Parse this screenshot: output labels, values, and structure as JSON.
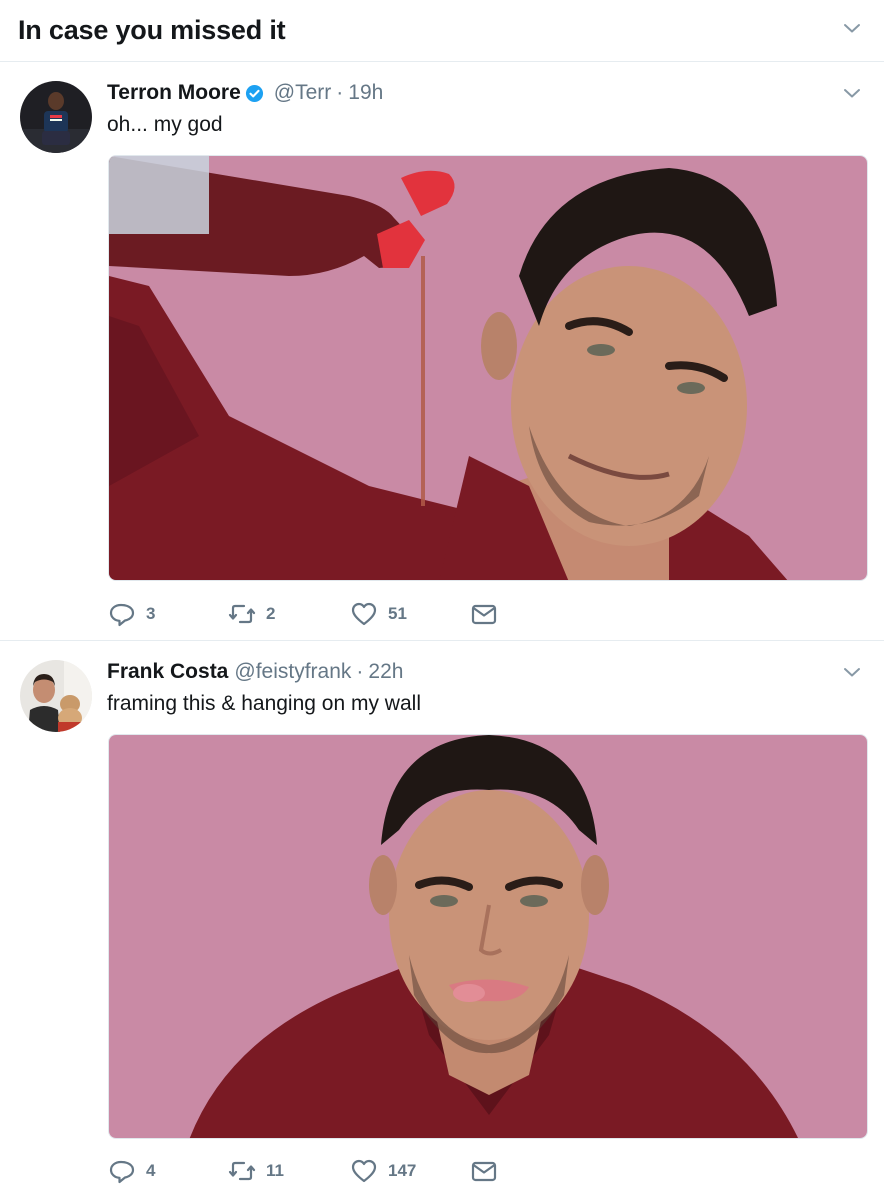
{
  "module": {
    "title": "In case you missed it"
  },
  "tweets": [
    {
      "fullname": "Terron Moore",
      "verified": true,
      "username": "@Terr",
      "separator": "·",
      "time": "19h",
      "text": "oh... my god",
      "actions": {
        "replies": "3",
        "retweets": "2",
        "likes": "51"
      }
    },
    {
      "fullname": "Frank Costa",
      "verified": false,
      "username": "@feistyfrank",
      "separator": "·",
      "time": "22h",
      "text": "framing this & hanging on my wall",
      "actions": {
        "replies": "4",
        "retweets": "11",
        "likes": "147"
      }
    }
  ],
  "colors": {
    "verified_blue": "#1da1f2",
    "secondary_text": "#657786",
    "divider": "#e6ecf0",
    "photo_background_pink": "#c98aa5",
    "robe_red": "#7a1a24"
  }
}
